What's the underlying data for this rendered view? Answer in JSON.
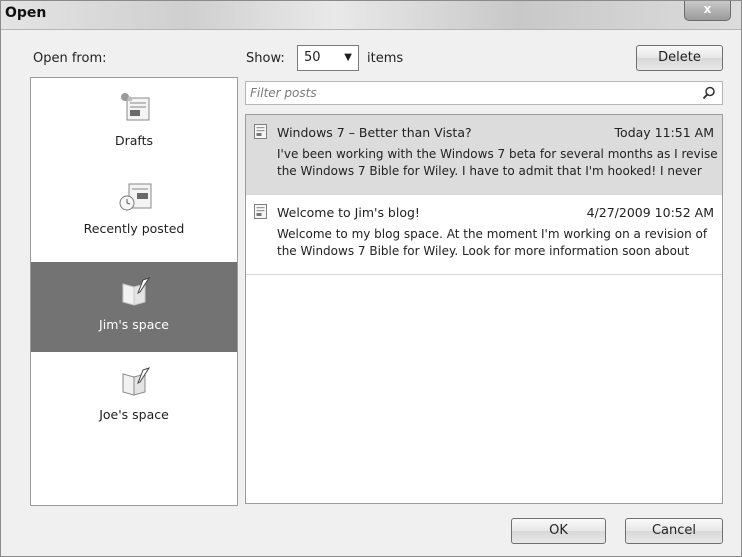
{
  "window": {
    "title": "Open",
    "close_label": "x"
  },
  "open_from": {
    "label": "Open from:",
    "sources": [
      {
        "label": "Drafts",
        "icon": "drafts-icon",
        "selected": false
      },
      {
        "label": "Recently posted",
        "icon": "recently-posted-icon",
        "selected": false
      },
      {
        "label": "Jim's space",
        "icon": "blog-space-icon",
        "selected": true
      },
      {
        "label": "Joe's space",
        "icon": "blog-space-icon",
        "selected": false
      }
    ]
  },
  "toolbar": {
    "show_label": "Show:",
    "show_value": "50",
    "items_label": "items",
    "delete_label": "Delete"
  },
  "filter": {
    "placeholder": "Filter posts",
    "icon": "search-icon"
  },
  "posts": [
    {
      "title": "Windows 7 – Better than Vista?",
      "date": "Today 11:51 AM",
      "excerpt_line1": "I've been working with the Windows 7 beta for several months as I revise",
      "excerpt_line2": "the Windows 7 Bible for Wiley. I have to admit that I'm hooked! I never",
      "selected": true
    },
    {
      "title": "Welcome to Jim's blog!",
      "date": "4/27/2009 10:52 AM",
      "excerpt_line1": "Welcome to my blog space. At the moment I'm working on a revision of",
      "excerpt_line2": "the Windows 7 Bible for Wiley. Look for more information soon about",
      "selected": false
    }
  ],
  "footer": {
    "ok_label": "OK",
    "cancel_label": "Cancel"
  },
  "colors": {
    "selected_source_bg": "#737373",
    "selected_post_bg": "#dcdcdc"
  }
}
